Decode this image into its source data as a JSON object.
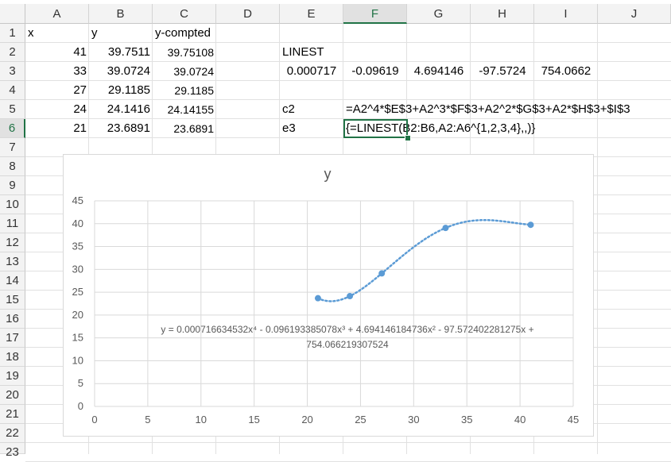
{
  "columns": [
    "A",
    "B",
    "C",
    "D",
    "E",
    "F",
    "G",
    "H",
    "I",
    "J"
  ],
  "rows": [
    "1",
    "2",
    "3",
    "4",
    "5",
    "6",
    "7",
    "8",
    "9",
    "10",
    "11",
    "12",
    "13",
    "14",
    "15",
    "16",
    "17",
    "18",
    "19",
    "20",
    "21",
    "22",
    "23"
  ],
  "cells": {
    "A1": "x",
    "B1": "y",
    "C1": "y-compted",
    "A2": "41",
    "B2": "39.7511",
    "C2": "39.75108",
    "E2": "LINEST",
    "A3": "33",
    "B3": "39.0724",
    "C3": "39.0724",
    "E3": "0.000717",
    "F3": "-0.09619",
    "G3": "4.694146",
    "H3": "-97.5724",
    "I3": "754.0662",
    "A4": "27",
    "B4": "29.1185",
    "C4": "29.1185",
    "A5": "24",
    "B5": "24.1416",
    "C5": "24.14155",
    "E5": "c2",
    "F5": "=A2^4*$E$3+A2^3*$F$3+A2^2*$G$3+A2*$H$3+$I$3",
    "A6": "21",
    "B6": "23.6891",
    "C6": "23.6891",
    "E6": "e3",
    "F6": "{=LINEST(B2:B6,A2:A6^{1,2,3,4},,)}"
  },
  "active_cell": "F6",
  "chart_data": {
    "type": "scatter",
    "title": "y",
    "xlabel": "",
    "ylabel": "",
    "xlim": [
      0,
      45
    ],
    "ylim": [
      0,
      45
    ],
    "xticks": [
      0,
      5,
      10,
      15,
      20,
      25,
      30,
      35,
      40,
      45
    ],
    "yticks": [
      0,
      5,
      10,
      15,
      20,
      25,
      30,
      35,
      40,
      45
    ],
    "grid": true,
    "series": [
      {
        "x": [
          41,
          33,
          27,
          24,
          21
        ],
        "y": [
          39.7511,
          39.0724,
          29.1185,
          24.1416,
          23.6891
        ],
        "color": "#5b9bd5"
      }
    ],
    "trendline": {
      "type": "polynomial",
      "order": 4,
      "coefficients": [
        0.000716634532,
        -0.096193385078,
        4.694146184736,
        -97.572402281275,
        754.066219307524
      ],
      "x_range": [
        21,
        41
      ],
      "color": "#5b9bd5",
      "style": "dotted",
      "equation_line1": "y = 0.000716634532x⁴ - 0.096193385078x³ + 4.694146184736x² - 97.572402281275x +",
      "equation_line2": "754.066219307524"
    }
  }
}
